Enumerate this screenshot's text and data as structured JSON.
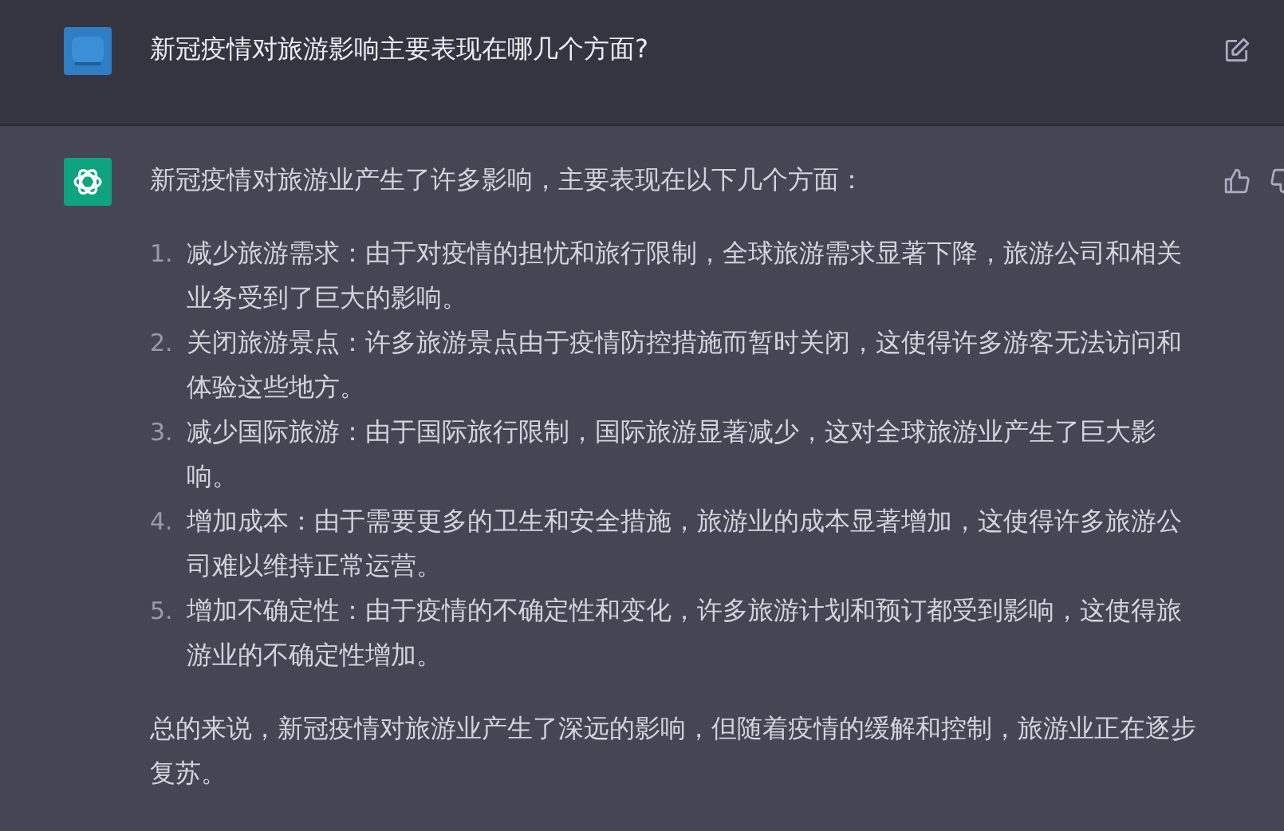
{
  "messages": [
    {
      "kind": "user",
      "text": "新冠疫情对旅游影响主要表现在哪几个方面?"
    },
    {
      "kind": "assistant",
      "intro": "新冠疫情对旅游业产生了许多影响，主要表现在以下几个方面：",
      "items": [
        {
          "number": "1.",
          "text": "减少旅游需求：由于对疫情的担忧和旅行限制，全球旅游需求显著下降，旅游公司和相关业务受到了巨大的影响。"
        },
        {
          "number": "2.",
          "text": "关闭旅游景点：许多旅游景点由于疫情防控措施而暂时关闭，这使得许多游客无法访问和体验这些地方。"
        },
        {
          "number": "3.",
          "text": "减少国际旅游：由于国际旅行限制，国际旅游显著减少，这对全球旅游业产生了巨大影响。"
        },
        {
          "number": "4.",
          "text": "增加成本：由于需要更多的卫生和安全措施，旅游业的成本显著增加，这使得许多旅游公司难以维持正常运营。"
        },
        {
          "number": "5.",
          "text": "增加不确定性：由于疫情的不确定性和变化，许多旅游计划和预订都受到影响，这使得旅游业的不确定性增加。"
        }
      ],
      "summary": "总的来说，新冠疫情对旅游业产生了深远的影响，但随着疫情的缓解和控制，旅游业正在逐步复苏。"
    }
  ]
}
